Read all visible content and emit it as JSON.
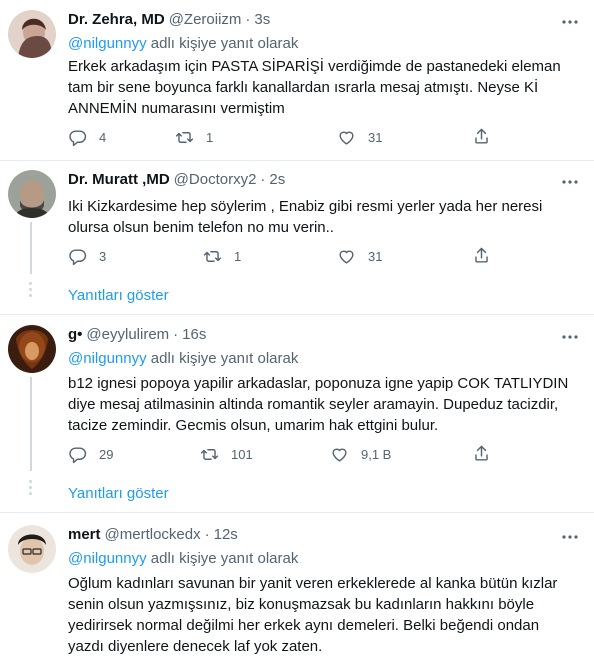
{
  "tweets": [
    {
      "name": "Dr. Zehra, MD",
      "handle": "@Zeroiizm",
      "separator": "·",
      "time": "3s",
      "reply_mention": "@nilgunnyy",
      "reply_suffix": " adlı kişiye yanıt olarak",
      "text": "Erkek arkadaşım için PASTA SİPARİŞİ verdiğimde de pastanedeki eleman\ntam bir sene boyunca farklı kanallardan ısrarla mesaj atmıştı. Neyse Kİ\nANNEMİN numarasını vermiştim",
      "replies": "4",
      "retweets": "1",
      "likes": "31",
      "avatar_colors": [
        "#d8c2b8",
        "#5a3b34"
      ]
    },
    {
      "name": "Dr. Muratt ,MD",
      "handle": "@Doctorxy2",
      "separator": "·",
      "time": "2s",
      "text": "Iki Kizkardesime hep söylerim , Enabiz gibi resmi yerler yada her neresi\nolursa olsun benim telefon no mu verin..",
      "replies": "3",
      "retweets": "1",
      "likes": "31",
      "show_replies": "Yanıtları göster",
      "avatar_colors": [
        "#8b8f8a",
        "#3e3f3c"
      ]
    },
    {
      "name": "g•",
      "handle": "@eyylulirem",
      "separator": "·",
      "time": "16s",
      "reply_mention": "@nilgunnyy",
      "reply_suffix": " adlı kişiye yanıt olarak",
      "text": "b12 ignesi popoya yapilir arkadaslar, poponuza igne yapip COK TATLIYDIN\ndiye mesaj atilmasinin altinda romantik seyler aramayin. Dupeduz tacizdir,\ntacize zemindir. Gecmis olsun, umarim hak ettgini bulur.",
      "replies": "29",
      "retweets": "101",
      "likes": "9,1 B",
      "show_replies": "Yanıtları göster",
      "avatar_colors": [
        "#c06a2b",
        "#4a2410"
      ]
    },
    {
      "name": "mert",
      "handle": "@mertlockedx",
      "separator": "·",
      "time": "12s",
      "reply_mention": "@nilgunnyy",
      "reply_suffix": " adlı kişiye yanıt olarak",
      "text": "Oğlum kadınları savunan bir yanit veren erkeklerede al kanka bütün kızlar\nsenin olsun yazmışsınız, biz konuşmazsak bu kadınların hakkını böyle\nyedirirsek normal değilmi her erkek aynı demeleri. Belki beğendi ondan\nyazdı diyenlere denecek laf yok zaten.",
      "avatar_colors": [
        "#d9cfc4",
        "#2b2622"
      ]
    }
  ]
}
